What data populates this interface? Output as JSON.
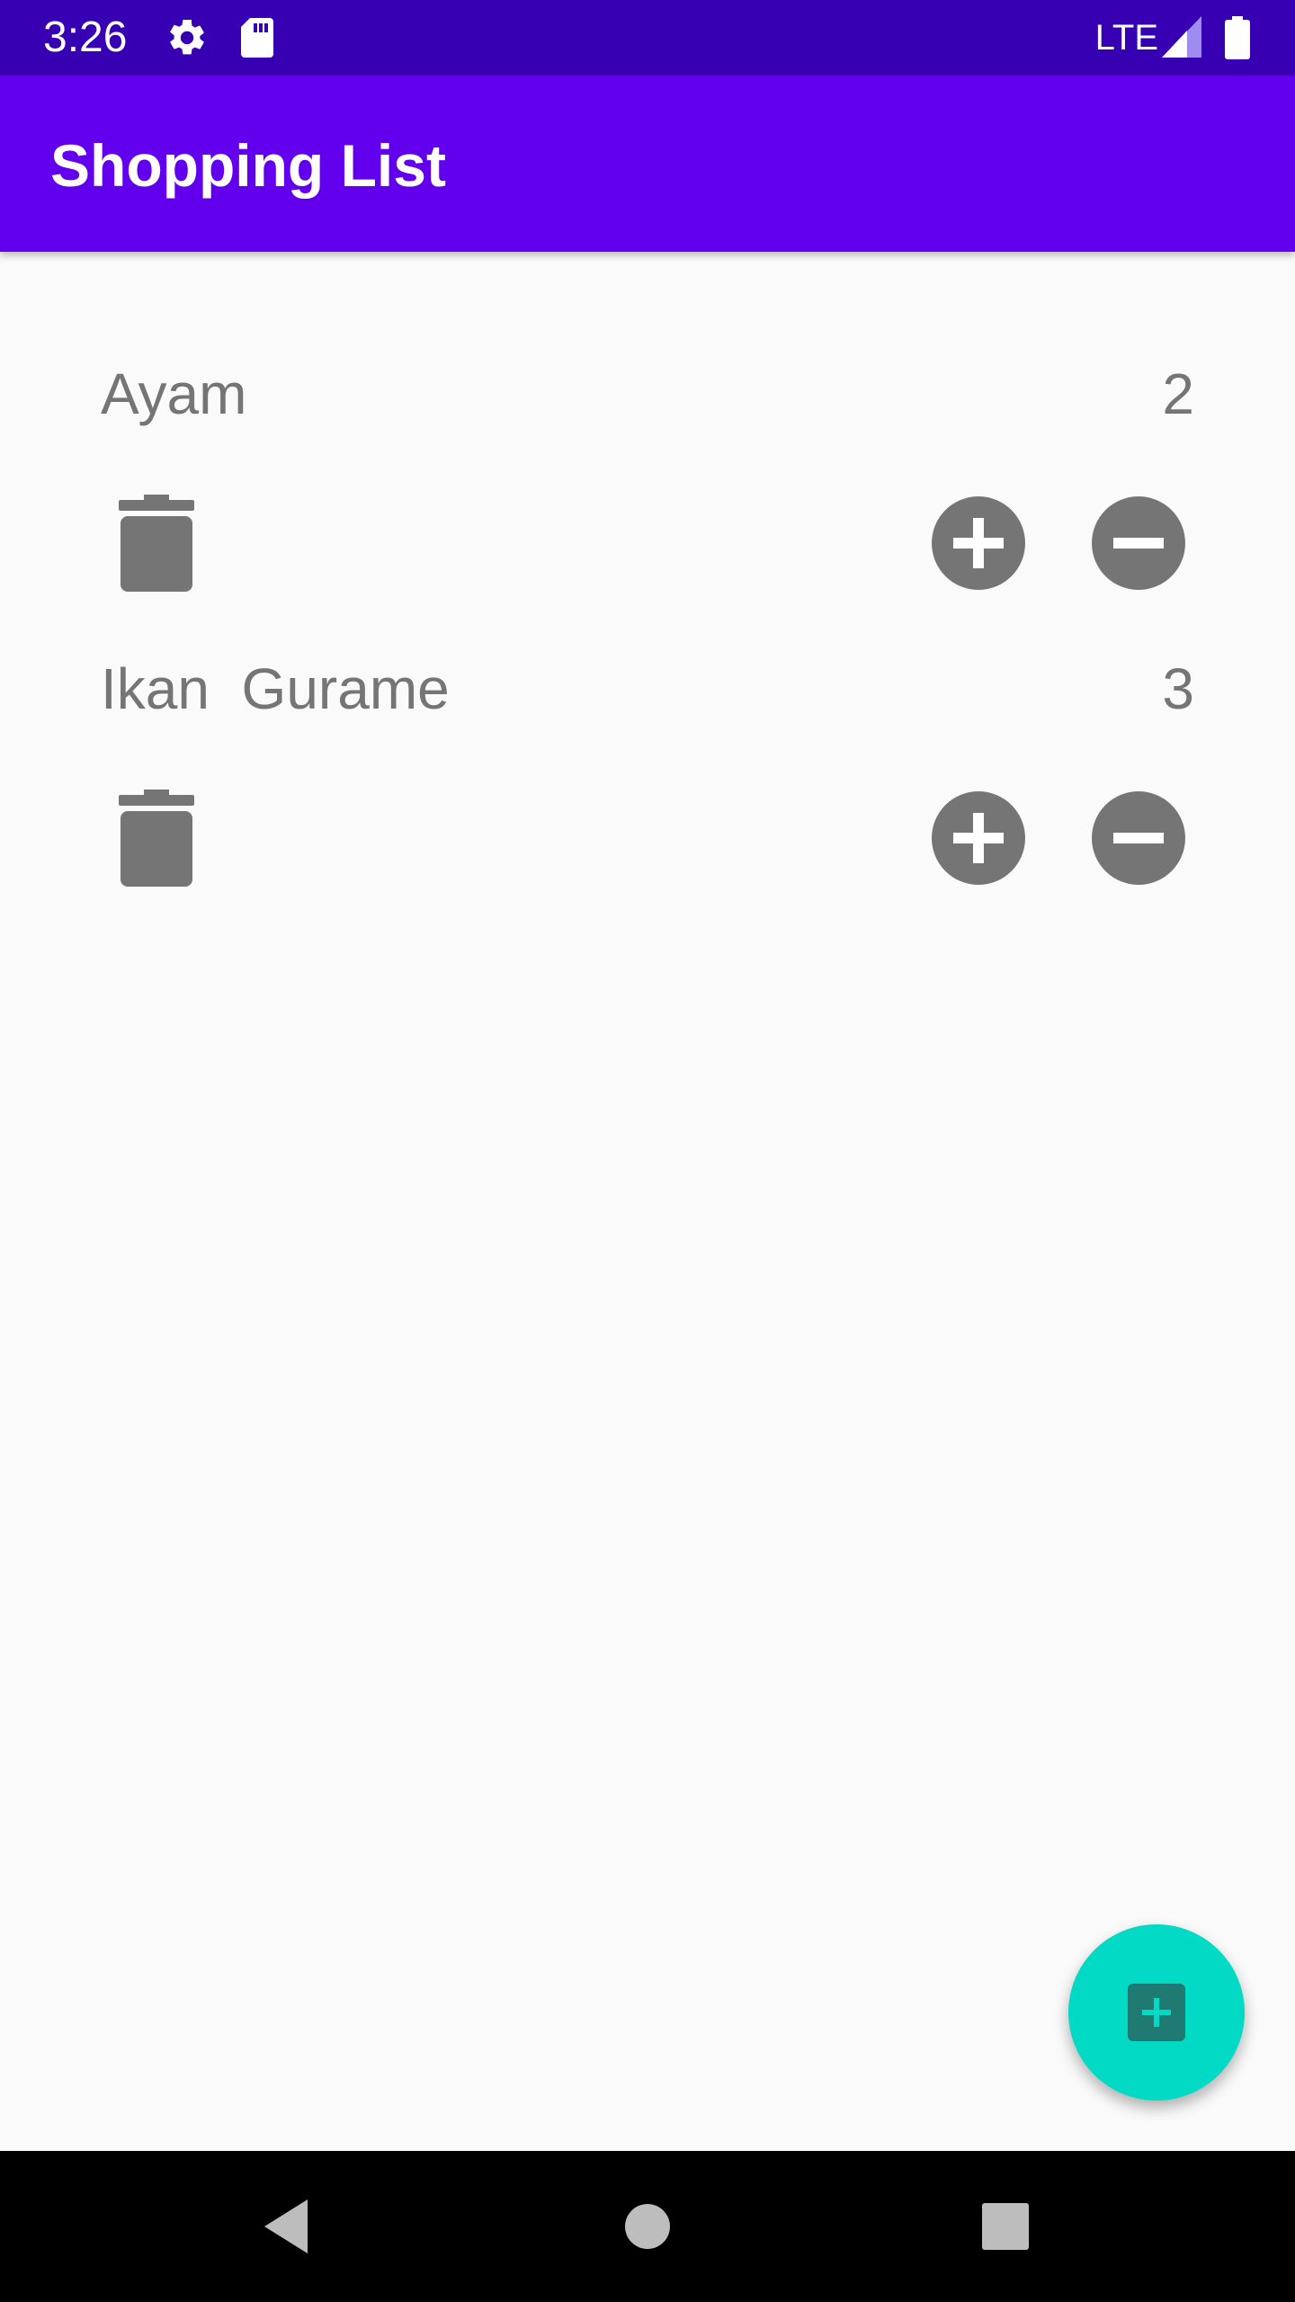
{
  "status_bar": {
    "time": "3:26",
    "network": "LTE",
    "icons": [
      "gear-icon",
      "sd-card-icon",
      "signal-icon",
      "battery-icon"
    ]
  },
  "app_bar": {
    "title": "Shopping List"
  },
  "items": [
    {
      "name": "Ayam",
      "quantity": "2"
    },
    {
      "name": "Ikan  Gurame",
      "quantity": "3"
    }
  ],
  "fab": {
    "icon": "add-box-icon"
  },
  "nav_bar": {
    "icons": [
      "back-icon",
      "home-icon",
      "recents-icon"
    ]
  },
  "colors": {
    "status_bar": "#3700b3",
    "app_bar": "#6200ee",
    "fab": "#03dac5",
    "fab_icon": "#1f7a72",
    "icon_gray": "#757575",
    "text_gray": "#757575",
    "background": "#fafafa"
  }
}
